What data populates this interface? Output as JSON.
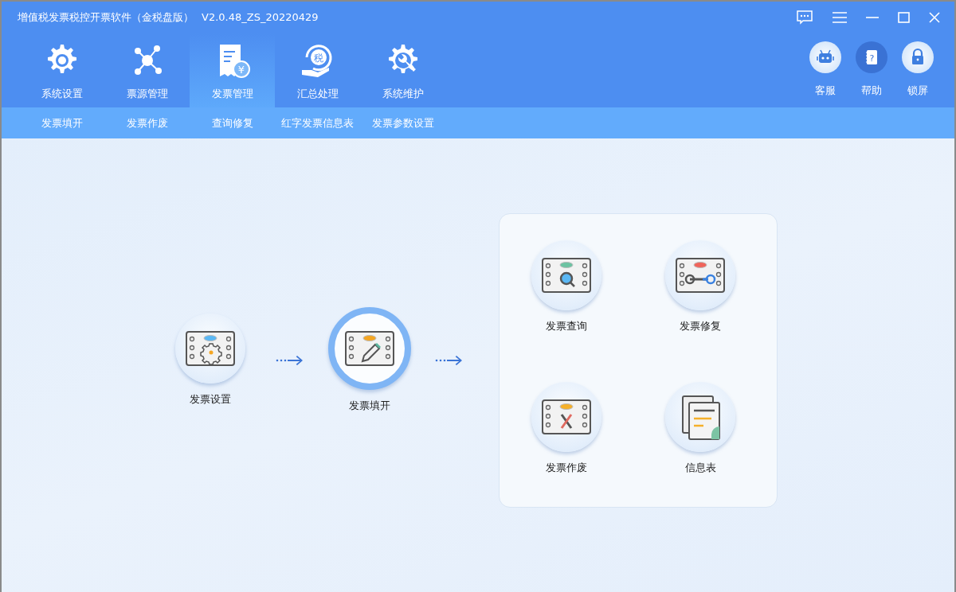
{
  "window": {
    "title": "增值税发票税控开票软件（金税盘版）",
    "version": "V2.0.48_ZS_20220429"
  },
  "main_tabs": [
    {
      "label": "系统设置",
      "kind": "gear",
      "selected": false
    },
    {
      "label": "票源管理",
      "kind": "network",
      "selected": false
    },
    {
      "label": "发票管理",
      "kind": "receipt",
      "glyph": "¥",
      "selected": true
    },
    {
      "label": "汇总处理",
      "kind": "tax",
      "glyph": "税",
      "selected": false
    },
    {
      "label": "系统维护",
      "kind": "maintenance",
      "selected": false
    }
  ],
  "quick_buttons": [
    {
      "label": "客服",
      "kind": "robot",
      "highlighted": false
    },
    {
      "label": "帮助",
      "kind": "help",
      "glyph": "?",
      "highlighted": true
    },
    {
      "label": "锁屏",
      "kind": "lock",
      "highlighted": false
    }
  ],
  "sub_tabs": [
    {
      "label": "发票填开"
    },
    {
      "label": "发票作废"
    },
    {
      "label": "查询修复"
    },
    {
      "label": "红字发票信息表"
    },
    {
      "label": "发票参数设置"
    }
  ],
  "flow": [
    {
      "label": "发票设置",
      "kind": "settings",
      "selected": false
    },
    {
      "label": "发票填开",
      "kind": "edit",
      "selected": true
    }
  ],
  "panel_items": [
    {
      "label": "发票查询",
      "kind": "search"
    },
    {
      "label": "发票修复",
      "kind": "repair"
    },
    {
      "label": "发票作废",
      "kind": "void"
    },
    {
      "label": "信息表",
      "kind": "sheet"
    }
  ]
}
